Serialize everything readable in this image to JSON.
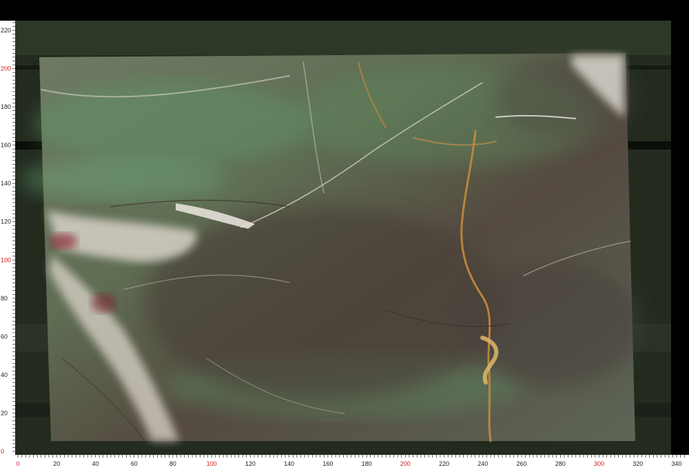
{
  "image": {
    "subject": "marble-slab",
    "colors": {
      "page_background": "#000000",
      "backdrop": "#232b1f",
      "slab_base": "#5f6b52",
      "slab_green": "#5e9a6b",
      "slab_dark": "#4a4037",
      "slab_light": "#d7d1c8",
      "vein_gold": "#c68a3c",
      "vein_red": "#8b2a35",
      "ruler_bg": "#ffffff",
      "ruler_tick": "#000000",
      "ruler_text": "#222222",
      "ruler_highlight": "#d21a1a"
    }
  },
  "ruler": {
    "left": {
      "labels": [
        "220",
        "200",
        "180",
        "160",
        "140",
        "120",
        "100",
        "80",
        "60",
        "40",
        "20",
        "0"
      ],
      "highlight": [
        "200",
        "100",
        "0"
      ]
    },
    "bottom": {
      "labels": [
        "0",
        "20",
        "40",
        "60",
        "80",
        "100",
        "120",
        "140",
        "160",
        "180",
        "200",
        "220",
        "240",
        "260",
        "280",
        "300",
        "320",
        "340"
      ],
      "highlight": [
        "0",
        "100",
        "200",
        "300"
      ]
    }
  }
}
